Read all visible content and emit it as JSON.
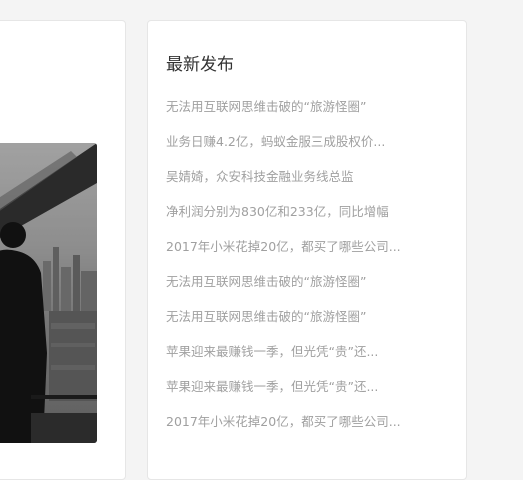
{
  "sidebar": {
    "title": "最新发布",
    "items": [
      {
        "label": "无法用互联网思维击破的“旅游怪圈”"
      },
      {
        "label": "业务日赚4.2亿，蚂蚁金服三成股权价..."
      },
      {
        "label": "吴婧婍，众安科技金融业务线总监"
      },
      {
        "label": "净利润分别为830亿和233亿，同比增幅"
      },
      {
        "label": "2017年小米花掉20亿，都买了哪些公司..."
      },
      {
        "label": "无法用互联网思维击破的“旅游怪圈”"
      },
      {
        "label": "无法用互联网思维击破的“旅游怪圈”"
      },
      {
        "label": "苹果迎来最赚钱一季，但光凭“贵”还..."
      },
      {
        "label": "苹果迎来最赚钱一季，但光凭“贵”还..."
      },
      {
        "label": "2017年小米花掉20亿，都买了哪些公司..."
      }
    ]
  }
}
